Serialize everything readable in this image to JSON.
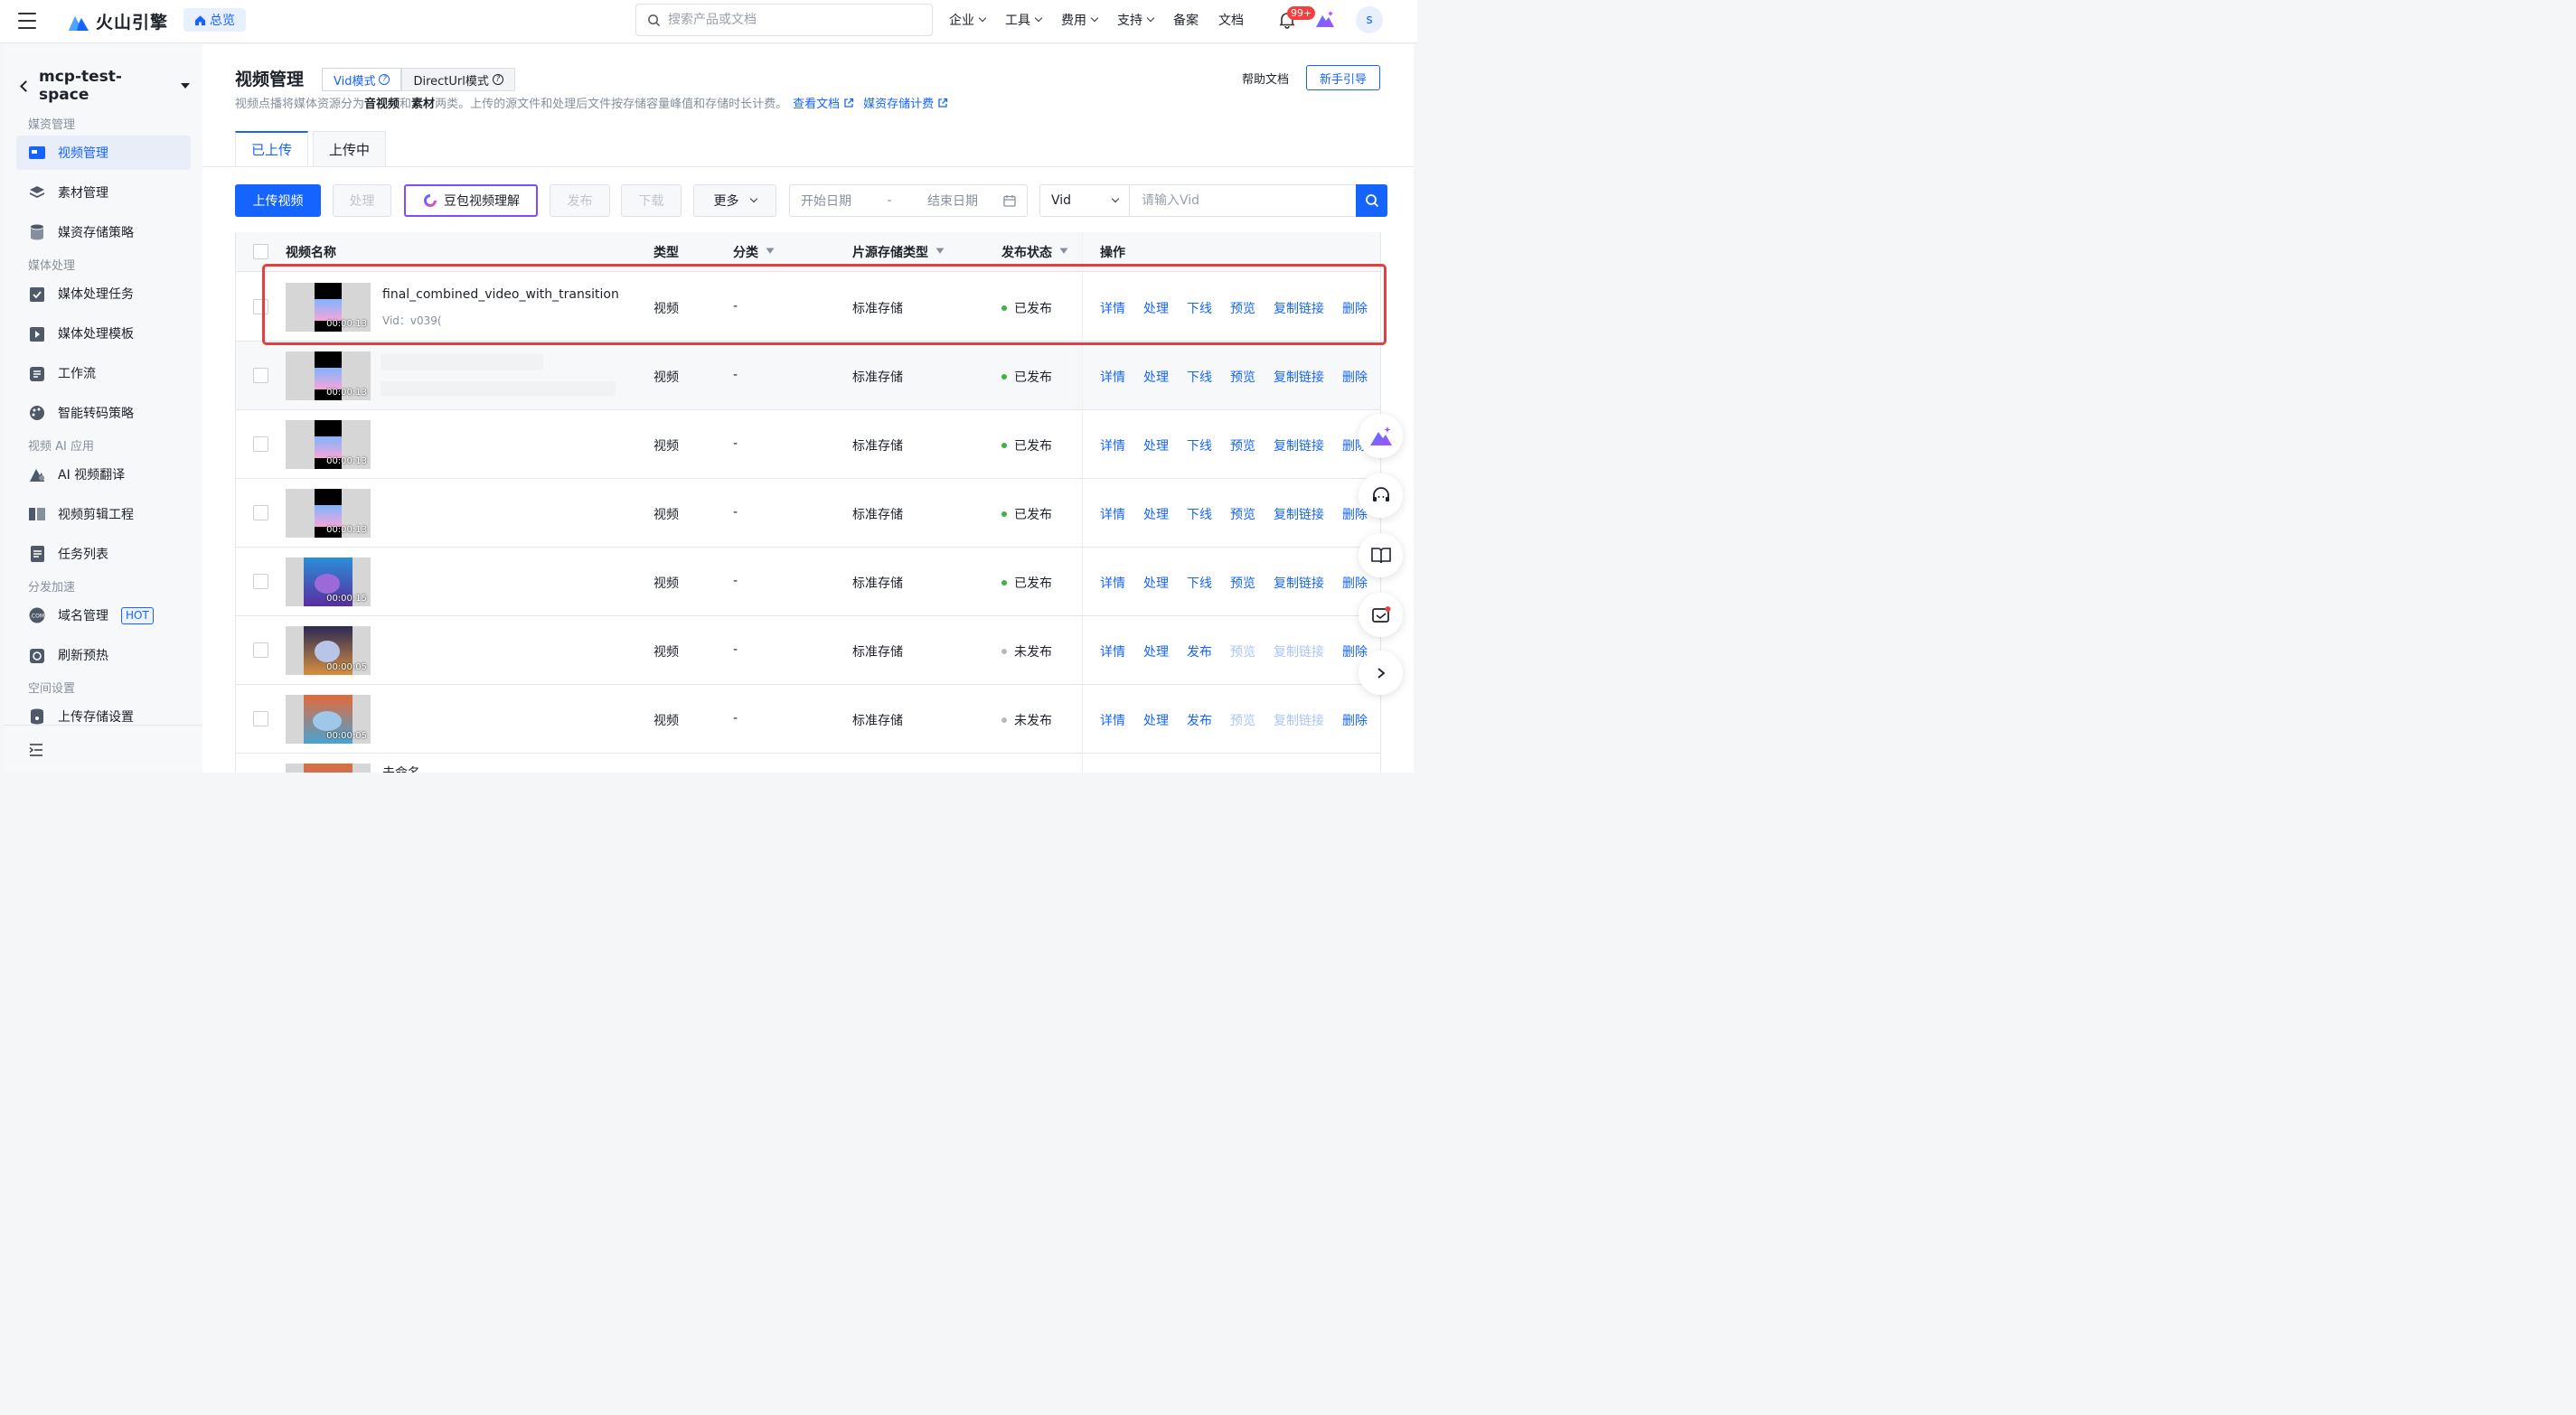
{
  "topbar": {
    "brand": "火山引擎",
    "overview": "总览",
    "search_placeholder": "搜索产品或文档",
    "nav": [
      "企业",
      "工具",
      "费用",
      "支持",
      "备案",
      "文档"
    ],
    "notifications": "99+",
    "avatar": "s"
  },
  "sidebar": {
    "space": "mcp-test-space",
    "groups": {
      "media": "媒资管理",
      "processing": "媒体处理",
      "ai": "视频 AI 应用",
      "dist": "分发加速",
      "space": "空间设置"
    },
    "items": {
      "video_mgmt": "视频管理",
      "material": "素材管理",
      "storage_policy": "媒资存储策略",
      "proc_task": "媒体处理任务",
      "proc_tpl": "媒体处理模板",
      "workflow": "工作流",
      "transcode": "智能转码策略",
      "ai_translate": "AI 视频翻译",
      "edit_project": "视频剪辑工程",
      "task_list": "任务列表",
      "domain": "域名管理",
      "refresh": "刷新预热",
      "upload_storage": "上传存储设置"
    },
    "hot": "HOT"
  },
  "page": {
    "title": "视频管理",
    "mode_vid": "Vid模式",
    "mode_direct": "DirectUrl模式",
    "desc_a": "视频点播将媒体资源分为",
    "desc_b": "音视频",
    "desc_c": "和",
    "desc_d": "素材",
    "desc_e": "两类。上传的源文件和处理后文件按存储容量峰值和存储时长计费。",
    "link_docs": "查看文档",
    "link_billing": "媒资存储计费",
    "help": "帮助文档",
    "guide": "新手引导",
    "tab_uploaded": "已上传",
    "tab_uploading": "上传中"
  },
  "toolbar": {
    "upload": "上传视频",
    "process": "处理",
    "doubao": "豆包视频理解",
    "publish": "发布",
    "download": "下载",
    "more": "更多",
    "start_date": "开始日期",
    "date_sep": "-",
    "end_date": "结束日期",
    "vid_select": "Vid",
    "vid_placeholder": "请输入Vid"
  },
  "table": {
    "headers": {
      "name": "视频名称",
      "type": "类型",
      "category": "分类",
      "storage": "片源存储类型",
      "status": "发布状态",
      "ops": "操作"
    },
    "rows": [
      {
        "name": "final_combined_video_with_transition",
        "vid": "Vid：v039(",
        "duration": "00:00:13",
        "type": "视频",
        "category": "-",
        "storage": "标准存储",
        "status": "已发布",
        "ops": [
          "详情",
          "处理",
          "下线",
          "预览",
          "复制链接",
          "删除"
        ]
      },
      {
        "name": "",
        "vid": "",
        "duration": "00:00:13",
        "type": "视频",
        "category": "-",
        "storage": "标准存储",
        "status": "已发布",
        "ops": [
          "详情",
          "处理",
          "下线",
          "预览",
          "复制链接",
          "删除"
        ]
      },
      {
        "name": "",
        "vid": "",
        "duration": "00:00:13",
        "type": "视频",
        "category": "-",
        "storage": "标准存储",
        "status": "已发布",
        "ops": [
          "详情",
          "处理",
          "下线",
          "预览",
          "复制链接",
          "删除"
        ]
      },
      {
        "name": "",
        "vid": "",
        "duration": "00:00:13",
        "type": "视频",
        "category": "-",
        "storage": "标准存储",
        "status": "已发布",
        "ops": [
          "详情",
          "处理",
          "下线",
          "预览",
          "复制链接",
          "删除"
        ]
      },
      {
        "name": "",
        "vid": "",
        "duration": "00:00:15",
        "type": "视频",
        "category": "-",
        "storage": "标准存储",
        "status": "已发布",
        "ops": [
          "详情",
          "处理",
          "下线",
          "预览",
          "复制链接",
          "删除"
        ]
      },
      {
        "name": "",
        "vid": "",
        "duration": "00:00:05",
        "type": "视频",
        "category": "-",
        "storage": "标准存储",
        "status": "未发布",
        "ops": [
          "详情",
          "处理",
          "发布",
          "预览",
          "复制链接",
          "删除"
        ]
      },
      {
        "name": "",
        "vid": "",
        "duration": "00:00:05",
        "type": "视频",
        "category": "-",
        "storage": "标准存储",
        "status": "未发布",
        "ops": [
          "详情",
          "处理",
          "发布",
          "预览",
          "复制链接",
          "删除"
        ]
      },
      {
        "name": "未命名",
        "vid": "",
        "duration": "",
        "type": "",
        "category": "",
        "storage": "",
        "status": "",
        "ops": []
      }
    ]
  },
  "colors": {
    "primary": "#1664ff",
    "published": "#3bb346",
    "unpublished": "#b5b9c0",
    "highlight": "#e33f3f"
  }
}
